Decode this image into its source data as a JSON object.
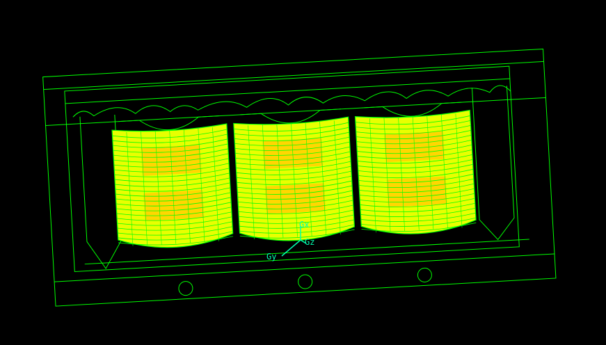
{
  "viewport": {
    "background": "#000000",
    "wire_color": "#00ff00",
    "fill_color": "#ffd700",
    "fill_highlight": "#e8ff00",
    "axis_color": "#00ffb0"
  },
  "model": {
    "coil_count": 3,
    "mount_hole_count": 3
  },
  "triad": {
    "x_label": "Gx",
    "y_label": "Gy",
    "z_label": "Gz",
    "icon": "coordinate-triad-icon"
  }
}
